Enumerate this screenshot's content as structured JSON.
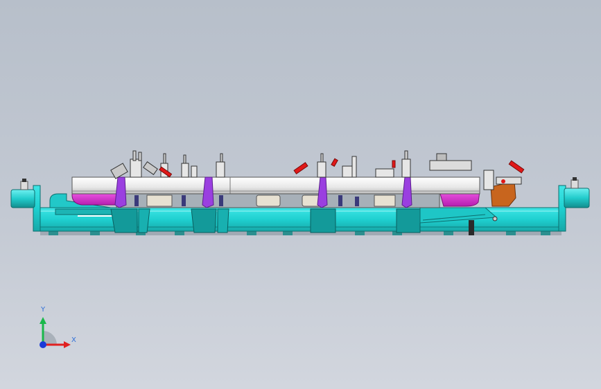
{
  "viewport": {
    "background_top": "#b7bfca",
    "background_bottom": "#d2d6de"
  },
  "model": {
    "colors": {
      "base": "#1fd6d6",
      "base_dark": "#139c9c",
      "panel": "#168f8f",
      "clamp_body": "#ececec",
      "beam": "#f2f2f2",
      "magenta": "#d92fd0",
      "purple": "#8a4dd6",
      "red_handle": "#e01818",
      "orange": "#c8651e",
      "steel": "#c9c9c9",
      "dark": "#2a2a2a"
    }
  },
  "triad": {
    "y_label": "Y",
    "x_label": "X",
    "y_color": "#19b84a",
    "x_color": "#e02020",
    "z_color": "#1a3ad8",
    "icon": "coordinate-triad-icon"
  }
}
